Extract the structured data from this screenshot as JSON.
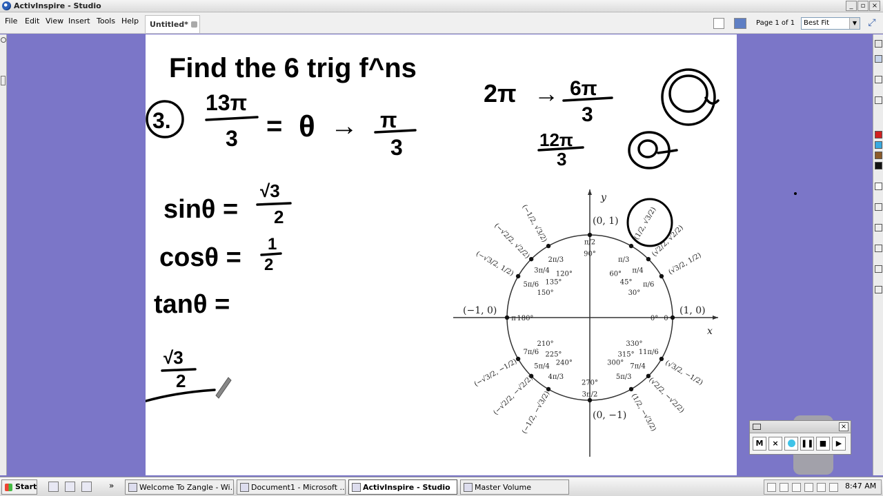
{
  "window": {
    "title": "ActivInspire - Studio"
  },
  "menu": {
    "items": [
      "File",
      "Edit",
      "View",
      "Insert",
      "Tools",
      "Help"
    ]
  },
  "tab": {
    "label": "Untitled*"
  },
  "toolbar": {
    "page_label": "Page 1 of 1",
    "zoom_value": "Best Fit",
    "overflow_label": "»"
  },
  "recorder": {
    "mute_label": "M",
    "cancel_label": "×"
  },
  "taskbar": {
    "start_label": "Start",
    "tasks": [
      {
        "label": "Welcome To Zangle - Wi..."
      },
      {
        "label": "Document1 - Microsoft ..."
      },
      {
        "label": "ActivInspire - Studio"
      },
      {
        "label": "Master Volume"
      }
    ],
    "clock": "8:47 AM"
  },
  "unit_circle": {
    "axis_x": "x",
    "axis_y": "y",
    "point_0": "(1, 0)",
    "point_90": "(0, 1)",
    "point_180": "(−1, 0)",
    "point_270": "(0, −1)",
    "deg_0": "0°",
    "deg_30": "30°",
    "deg_45": "45°",
    "deg_60": "60°",
    "deg_90": "90°",
    "deg_120": "120°",
    "deg_135": "135°",
    "deg_150": "150°",
    "deg_180": "180°",
    "deg_210": "210°",
    "deg_225": "225°",
    "deg_240": "240°",
    "deg_270": "270°",
    "deg_300": "300°",
    "deg_315": "315°",
    "deg_330": "330°",
    "rad_0": "0",
    "rad_180": "π",
    "rad_90": "π/2",
    "rad_270": "3π/2",
    "rad_30": "π/6",
    "rad_45": "π/4",
    "rad_60": "π/3",
    "rad_120": "2π/3",
    "rad_135": "3π/4",
    "rad_150": "5π/6",
    "rad_210": "7π/6",
    "rad_225": "5π/4",
    "rad_240": "4π/3",
    "rad_300": "5π/3",
    "rad_315": "7π/4",
    "rad_330": "11π/6",
    "coord_30": "(√3/2, 1/2)",
    "coord_45": "(√2/2, √2/2)",
    "coord_60": "(1/2, √3/2)",
    "coord_120": "(−1/2, √3/2)",
    "coord_135": "(−√2/2, √2/2)",
    "coord_150": "(−√3/2, 1/2)",
    "coord_210": "(−√3/2, −1/2)",
    "coord_225": "(−√2/2, −√2/2)",
    "coord_240": "(−1/2, −√3/2)",
    "coord_300": "(1/2, −√3/2)",
    "coord_315": "(√2/2, −√2/2)",
    "coord_330": "(√3/2, −1/2)"
  },
  "handwriting": {
    "heading": "Find the 6 trig f^ns",
    "problem_number": "3.",
    "frac1_num": "13π",
    "frac1_den": "3",
    "equals": "=",
    "theta": "θ",
    "arrow": "→",
    "ref_num": "π",
    "ref_den": "3",
    "two_pi": "2π",
    "six_pi_num": "6π",
    "six_pi_den": "3",
    "twelve_pi_num": "12π",
    "twelve_pi_den": "3",
    "sin_line": "sinθ =",
    "sin_num": "√3",
    "sin_den": "2",
    "cos_line": "cosθ =",
    "cos_num": "1",
    "cos_den": "2",
    "tan_line": "tanθ =",
    "tan_num": "√3",
    "tan_den": "2"
  }
}
